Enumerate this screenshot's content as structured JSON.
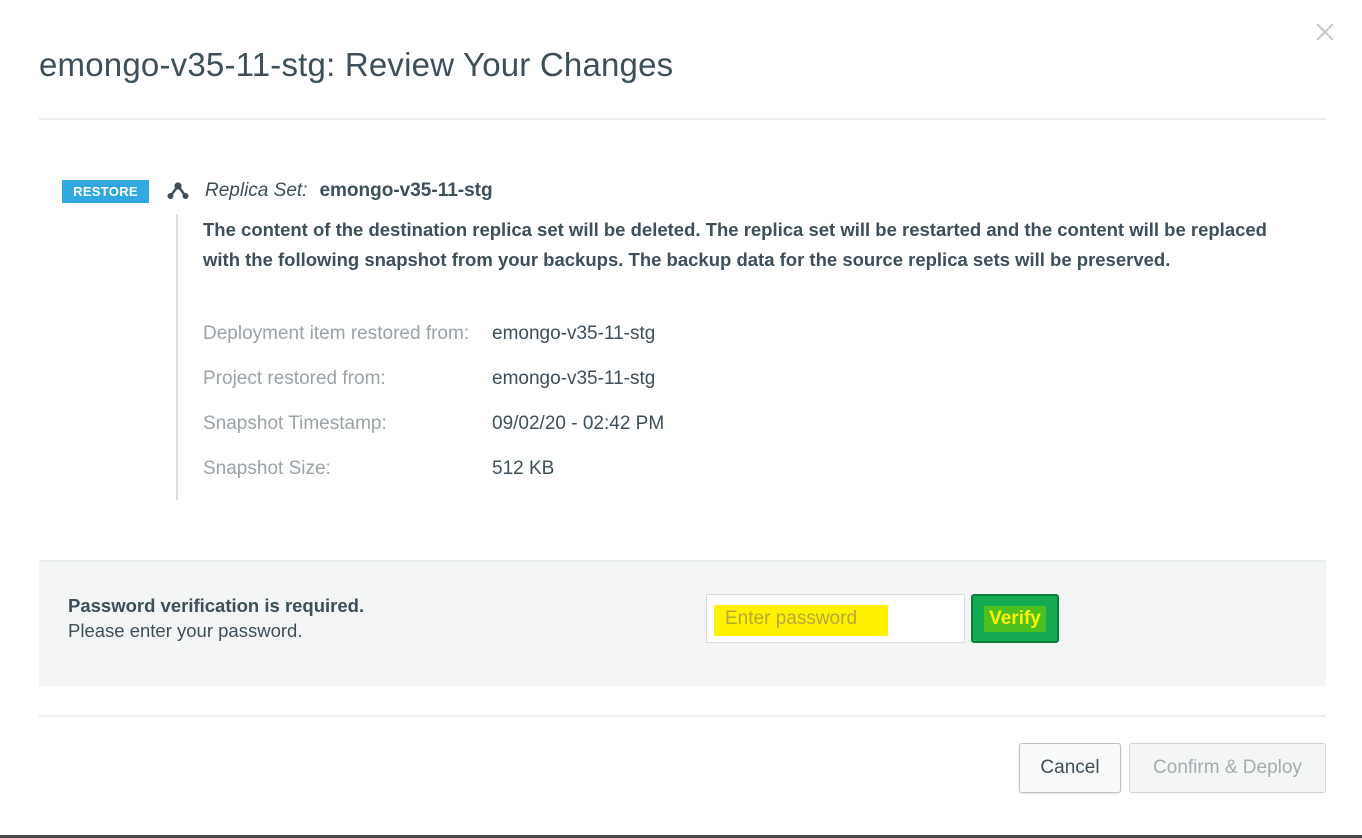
{
  "modal": {
    "title": "emongo-v35-11-stg: Review Your Changes",
    "close_icon": "close-icon"
  },
  "change": {
    "badge": "RESTORE",
    "badge_color": "#31a9e0",
    "icon": "replica-set-icon",
    "type_label": "Replica Set:",
    "name": "emongo-v35-11-stg",
    "warning": "The content of the destination replica set will be deleted. The replica set will be restarted and the content will be replaced with the following snapshot from your backups. The backup data for the source replica sets will be preserved.",
    "details": [
      {
        "key": "Deployment item restored from:",
        "value": "emongo-v35-11-stg"
      },
      {
        "key": "Project restored from:",
        "value": "emongo-v35-11-stg"
      },
      {
        "key": "Snapshot Timestamp:",
        "value": "09/02/20 - 02:42 PM"
      },
      {
        "key": "Snapshot Size:",
        "value": "512 KB"
      }
    ]
  },
  "password": {
    "title": "Password verification is required.",
    "subtitle": "Please enter your password.",
    "placeholder": "Enter password",
    "value": "",
    "verify_label": "Verify",
    "highlight_color": "#fff200",
    "verify_color": "#13aa52"
  },
  "footer": {
    "cancel_label": "Cancel",
    "confirm_label": "Confirm & Deploy",
    "confirm_disabled": true
  }
}
